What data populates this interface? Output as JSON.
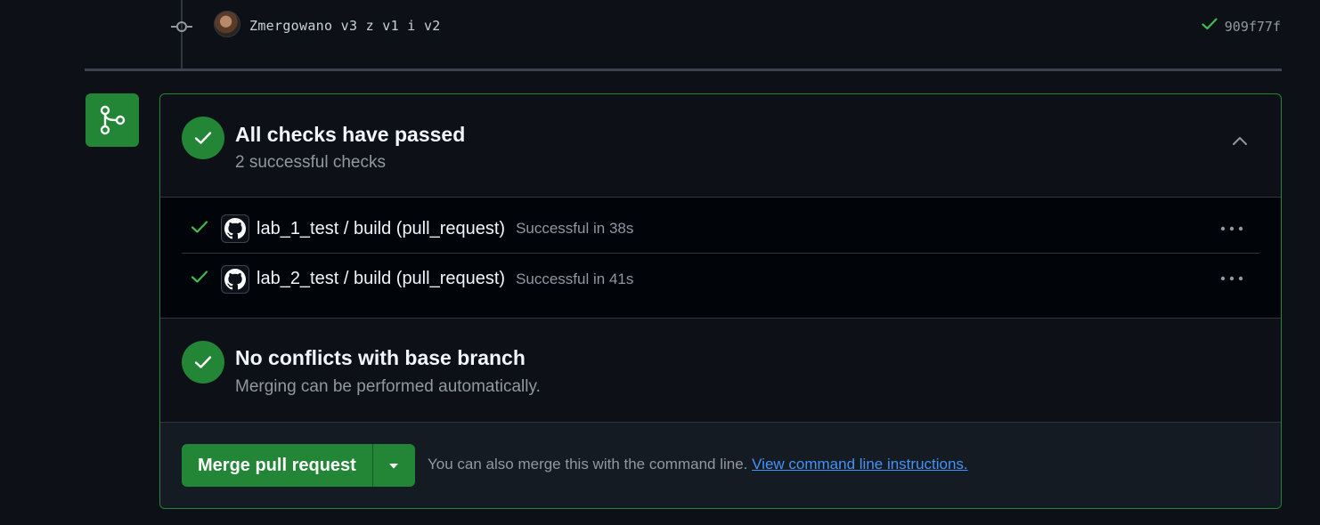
{
  "commit": {
    "message": "Zmergowano v3 z v1 i v2",
    "sha": "909f77f"
  },
  "checks_section": {
    "title": "All checks have passed",
    "subtitle": "2 successful checks",
    "checks": [
      {
        "name": "lab_1_test / build (pull_request)",
        "status": "Successful in 38s"
      },
      {
        "name": "lab_2_test / build (pull_request)",
        "status": "Successful in 41s"
      }
    ]
  },
  "conflicts_section": {
    "title": "No conflicts with base branch",
    "subtitle": "Merging can be performed automatically."
  },
  "merge": {
    "button_label": "Merge pull request",
    "hint_text": "You can also merge this with the command line.",
    "link_text": "View command line instructions."
  },
  "colors": {
    "success": "#238636",
    "success_icon": "#3fb950",
    "link": "#4493f8",
    "background": "#0d1117"
  },
  "icons": {
    "commit": "git-commit-icon",
    "merge": "git-merge-icon",
    "check": "check-icon",
    "collapse": "chevron-up-icon",
    "github": "github-logo-icon",
    "more": "kebab-horizontal-icon",
    "dropdown": "triangle-down-icon"
  }
}
